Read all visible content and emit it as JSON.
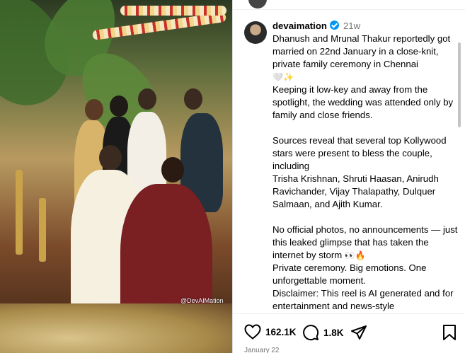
{
  "post": {
    "username": "devaimation",
    "time_ago": "21w",
    "watermark": "@DevAIMation",
    "caption_line1": "Dhanush and Mrunal Thakur reportedly got married on 22nd January in a close-knit, private family ceremony in Chennai",
    "caption_line1_emoji": "🤍✨",
    "caption_para2": "Keeping it low-key and away from the spotlight, the wedding was attended only by family and close friends.",
    "caption_para3": "Sources reveal that several top Kollywood stars were present to bless the couple, including",
    "caption_para3_names": "Trisha Krishnan, Shruti Haasan, Anirudh Ravichander, Vijay Thalapathy, Dulquer Salmaan, and Ajith Kumar.",
    "caption_para4": "No official photos, no announcements — just this leaked glimpse that has taken the internet by storm",
    "caption_para4_emoji": "👀🔥",
    "caption_para5": "Private ceremony. Big emotions. One unforgettable moment.",
    "caption_para6": "Disclaimer: This reel is AI generated and for entertainment and news-style",
    "likes": "162.1K",
    "comments": "1.8K",
    "date": "January 22"
  },
  "icons": [
    "heart-icon",
    "comment-icon",
    "share-icon",
    "bookmark-icon",
    "verified-icon"
  ],
  "colors": {
    "verified": "#0095f6",
    "muted": "#737373"
  }
}
